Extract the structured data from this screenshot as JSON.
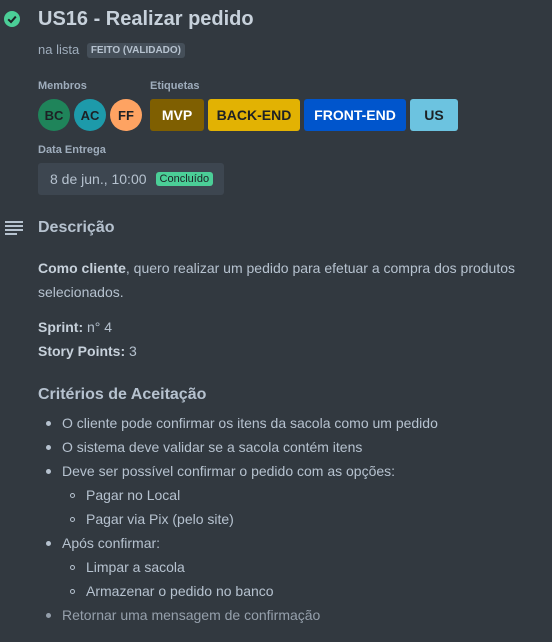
{
  "card": {
    "title": "US16 - Realizar pedido",
    "list_prefix": "na lista",
    "list_name": "FEITO (VALIDADO)"
  },
  "members": {
    "heading": "Membros",
    "items": [
      {
        "initials": "BC",
        "color": "#1f845a"
      },
      {
        "initials": "AC",
        "color": "#1d9aaa"
      },
      {
        "initials": "FF",
        "color": "#fea362"
      }
    ]
  },
  "labels": {
    "heading": "Etiquetas",
    "items": [
      {
        "text": "MVP",
        "bg": "#7f5f01",
        "fg": "#ffffff"
      },
      {
        "text": "BACK-END",
        "bg": "#e2b203",
        "fg": "#1d2125"
      },
      {
        "text": "FRONT-END",
        "bg": "#0055cc",
        "fg": "#ffffff"
      },
      {
        "text": "US",
        "bg": "#6cc3e0",
        "fg": "#1d2125"
      }
    ]
  },
  "due": {
    "heading": "Data Entrega",
    "date": "8 de jun., 10:00",
    "status": "Concluído"
  },
  "description": {
    "heading": "Descrição",
    "line1_bold": "Como cliente",
    "line1_rest": ", quero realizar um pedido para efetuar a compra dos produtos",
    "line2": "selecionados.",
    "sprint_label": "Sprint:",
    "sprint_value": " n° 4",
    "points_label": "Story Points:",
    "points_value": " 3"
  },
  "criteria": {
    "heading": "Critérios de Aceitação",
    "items": [
      "O cliente pode confirmar os itens da sacola como um pedido",
      "O sistema deve validar se a sacola contém itens",
      "Deve ser possível confirmar o pedido com as opções:",
      "Pagar no Local",
      "Pagar via Pix (pelo site)",
      "Após confirmar:",
      "Limpar a sacola",
      "Armazenar o pedido no banco",
      "Retornar uma mensagem de confirmação"
    ]
  }
}
